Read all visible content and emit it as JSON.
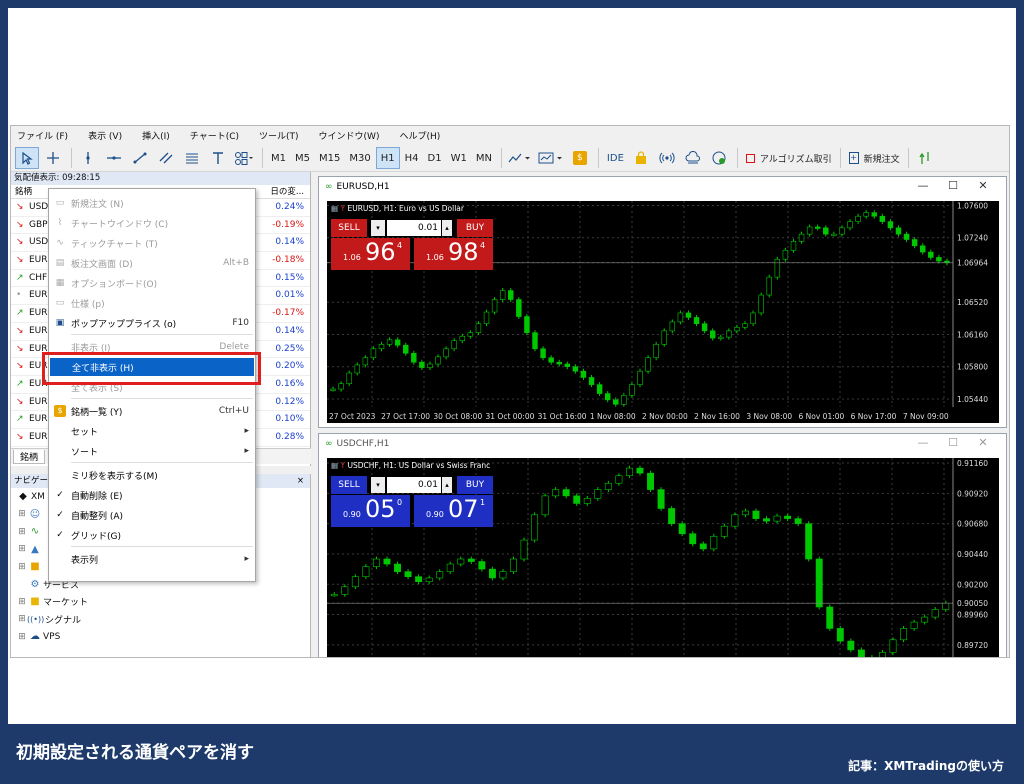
{
  "menu": [
    "ファイル (F)",
    "表示 (V)",
    "挿入(I)",
    "チャート(C)",
    "ツール(T)",
    "ウインドウ(W)",
    "ヘルプ(H)"
  ],
  "toolbar": {
    "timeframes": [
      "M1",
      "M5",
      "M15",
      "M30",
      "H1",
      "H4",
      "D1",
      "W1",
      "MN"
    ],
    "active_timeframe": "H1",
    "ide": "IDE",
    "algo": "アルゴリズム取引",
    "new_order": "新規注文"
  },
  "market_watch": {
    "title": "気配値表示: 09:28:15",
    "col_symbol": "銘柄",
    "col_change": "日の変...",
    "rows": [
      {
        "sym": "USD",
        "dir": "down",
        "chg": "0.24%",
        "pos": true
      },
      {
        "sym": "GBP",
        "dir": "down",
        "chg": "-0.19%",
        "pos": false
      },
      {
        "sym": "USD",
        "dir": "down",
        "chg": "0.14%",
        "pos": true
      },
      {
        "sym": "EUR",
        "dir": "down",
        "chg": "-0.18%",
        "pos": false
      },
      {
        "sym": "CHF",
        "dir": "up",
        "chg": "0.15%",
        "pos": true
      },
      {
        "sym": "EUR",
        "dir": "flat",
        "chg": "0.01%",
        "pos": true
      },
      {
        "sym": "EUR",
        "dir": "up",
        "chg": "-0.17%",
        "pos": false
      },
      {
        "sym": "EUR",
        "dir": "down",
        "chg": "0.14%",
        "pos": true
      },
      {
        "sym": "EUR",
        "dir": "down",
        "chg": "0.25%",
        "pos": true
      },
      {
        "sym": "EUR",
        "dir": "down",
        "chg": "0.20%",
        "pos": true
      },
      {
        "sym": "EUR",
        "dir": "up",
        "chg": "0.16%",
        "pos": true
      },
      {
        "sym": "EUR",
        "dir": "down",
        "chg": "0.12%",
        "pos": true
      },
      {
        "sym": "EUR",
        "dir": "up",
        "chg": "0.10%",
        "pos": true
      },
      {
        "sym": "EUR",
        "dir": "down",
        "chg": "0.28%",
        "pos": true
      }
    ],
    "tab": "銘柄"
  },
  "navigator": {
    "title": "ナビゲー",
    "items": [
      "XM",
      "",
      "",
      "",
      "",
      "サービス",
      "マーケット",
      "シグナル",
      "VPS"
    ]
  },
  "context_menu": [
    {
      "label": "新規注文 (N)",
      "key": "",
      "disabled": true,
      "icon": "doc"
    },
    {
      "label": "チャートウインドウ (C)",
      "key": "",
      "disabled": true,
      "icon": "chart"
    },
    {
      "label": "ティックチャート (T)",
      "key": "",
      "disabled": true,
      "icon": "tick"
    },
    {
      "label": "板注文画面 (D)",
      "key": "Alt+B",
      "disabled": true,
      "icon": "book"
    },
    {
      "label": "オプションボード(O)",
      "key": "",
      "disabled": true,
      "icon": "opt"
    },
    {
      "label": "仕様 (p)",
      "key": "",
      "disabled": true,
      "icon": "spec"
    },
    {
      "label": "ポップアッププライス (o)",
      "key": "F10",
      "disabled": false,
      "icon": "popup"
    },
    {
      "label": "非表示 (I)",
      "key": "Delete",
      "disabled": true,
      "icon": ""
    },
    {
      "label": "全て非表示 (H)",
      "key": "",
      "disabled": false,
      "icon": "",
      "highlight": true
    },
    {
      "label": "全て表示 (S)",
      "key": "",
      "disabled": true,
      "icon": ""
    },
    {
      "label": "銘柄一覧 (Y)",
      "key": "Ctrl+U",
      "disabled": false,
      "icon": "coin"
    },
    {
      "label": "セット",
      "key": "▸",
      "disabled": false,
      "icon": ""
    },
    {
      "label": "ソート",
      "key": "▸",
      "disabled": false,
      "icon": ""
    },
    {
      "label": "ミリ秒を表示する(M)",
      "key": "",
      "disabled": false,
      "icon": ""
    },
    {
      "label": "自動削除 (E)",
      "key": "",
      "disabled": false,
      "icon": "check"
    },
    {
      "label": "自動整列 (A)",
      "key": "",
      "disabled": false,
      "icon": "check"
    },
    {
      "label": "グリッド(G)",
      "key": "",
      "disabled": false,
      "icon": "check"
    },
    {
      "label": "表示列",
      "key": "▸",
      "disabled": false,
      "icon": ""
    }
  ],
  "chart1": {
    "window_title": "EURUSD,H1",
    "info": "EURUSD, H1:  Euro vs US Dollar",
    "sell": "SELL",
    "buy": "BUY",
    "lot": "0.01",
    "bid_prefix": "1.06",
    "bid_big": "96",
    "bid_sup": "4",
    "ask_prefix": "1.06",
    "ask_big": "98",
    "ask_sup": "4",
    "y_ticks": [
      "1.07600",
      "1.07240",
      "1.06964",
      "1.06520",
      "1.06160",
      "1.05800",
      "1.05440"
    ],
    "x_ticks": [
      "27 Oct 2023",
      "27 Oct 17:00",
      "30 Oct 08:00",
      "31 Oct 00:00",
      "31 Oct 16:00",
      "1 Nov 08:00",
      "2 Nov 00:00",
      "2 Nov 16:00",
      "3 Nov 08:00",
      "6 Nov 01:00",
      "6 Nov 17:00",
      "7 Nov 09:00"
    ],
    "closes": [
      1.0555,
      1.0561,
      1.0573,
      1.0582,
      1.059,
      1.06,
      1.0605,
      1.061,
      1.0604,
      1.0595,
      1.0585,
      1.0579,
      1.0583,
      1.0591,
      1.06,
      1.0609,
      1.0614,
      1.0618,
      1.0628,
      1.0641,
      1.0655,
      1.0665,
      1.0655,
      1.0636,
      1.0618,
      1.06,
      1.059,
      1.0585,
      1.0583,
      1.058,
      1.0575,
      1.0568,
      1.056,
      1.055,
      1.0543,
      1.0538,
      1.0548,
      1.056,
      1.0575,
      1.059,
      1.0605,
      1.062,
      1.063,
      1.064,
      1.0635,
      1.0628,
      1.062,
      1.0612,
      1.0613,
      1.062,
      1.0624,
      1.0628,
      1.064,
      1.066,
      1.068,
      1.07,
      1.071,
      1.072,
      1.0728,
      1.0736,
      1.0735,
      1.0728,
      1.0728,
      1.0735,
      1.0742,
      1.0748,
      1.0752,
      1.0748,
      1.0742,
      1.0735,
      1.0728,
      1.0722,
      1.0715,
      1.0708,
      1.0702,
      1.0698,
      1.0696
    ],
    "ylim": [
      1.0535,
      1.0765
    ]
  },
  "chart2": {
    "window_title": "USDCHF,H1",
    "info": "USDCHF, H1:  US Dollar vs Swiss Franc",
    "sell": "SELL",
    "buy": "BUY",
    "lot": "0.01",
    "bid_prefix": "0.90",
    "bid_big": "05",
    "bid_sup": "0",
    "ask_prefix": "0.90",
    "ask_big": "07",
    "ask_sup": "1",
    "y_ticks": [
      "0.91160",
      "0.90920",
      "0.90680",
      "0.90440",
      "0.90200",
      "0.90050",
      "0.89960",
      "0.89720"
    ],
    "closes": [
      0.9012,
      0.9018,
      0.9026,
      0.9034,
      0.904,
      0.9036,
      0.903,
      0.9026,
      0.9022,
      0.9025,
      0.903,
      0.9036,
      0.904,
      0.9038,
      0.9032,
      0.9025,
      0.903,
      0.904,
      0.9055,
      0.9075,
      0.909,
      0.9095,
      0.909,
      0.9084,
      0.9088,
      0.9095,
      0.91,
      0.9106,
      0.9112,
      0.9108,
      0.9095,
      0.908,
      0.9068,
      0.906,
      0.9052,
      0.9048,
      0.9058,
      0.9066,
      0.9075,
      0.9078,
      0.9072,
      0.907,
      0.9074,
      0.9072,
      0.9068,
      0.904,
      0.9002,
      0.8985,
      0.8975,
      0.8968,
      0.8962,
      0.8958,
      0.8966,
      0.8976,
      0.8985,
      0.899,
      0.8994,
      0.9,
      0.9005
    ],
    "ylim": [
      0.896,
      0.912
    ]
  },
  "footer": {
    "title": "初期設定される通貨ペアを消す",
    "credit": "記事：XMTradingの使い方"
  },
  "colors": {
    "frame": "#1d3a6b",
    "sell": "#c21a1a",
    "buy_red": "#c21a1a",
    "panel_blue": "#1f2fc4",
    "candle": "#00c800",
    "highlight": "#0a64c8",
    "callout": "#e01e1e"
  }
}
